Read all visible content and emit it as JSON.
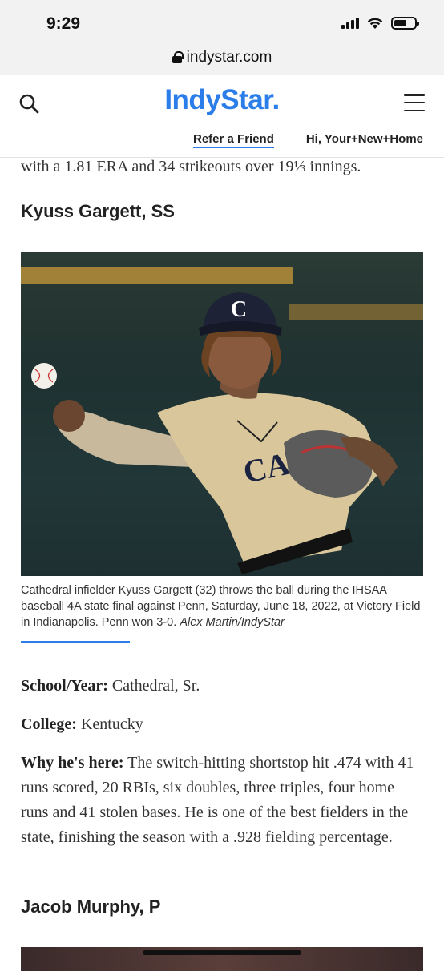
{
  "status": {
    "time": "9:29"
  },
  "browser": {
    "url": "indystar.com"
  },
  "header": {
    "logo_part1": "Indy",
    "logo_part2": "Star",
    "logo_dot": ".",
    "refer_label": "Refer a Friend",
    "greeting": "Hi, Your+New+Home"
  },
  "article": {
    "lead_line": "with a 1.81 ERA and 34 strikeouts over 19⅓ innings.",
    "player1": {
      "heading": "Kyuss Gargett, SS",
      "caption": "Cathedral infielder Kyuss Gargett (32) throws the ball during the IHSAA baseball 4A state final against Penn, Saturday, June 18, 2022, at Victory Field in Indianapolis. Penn won 3-0.",
      "credit": "Alex Martin/IndyStar",
      "school_label": "School/Year:",
      "school_value": "Cathedral, Sr.",
      "college_label": "College:",
      "college_value": "Kentucky",
      "why_label": "Why he's here:",
      "why_value": "The switch-hitting shortstop hit .474 with 41 runs scored, 20 RBIs, six doubles, three triples, four home runs and 41 stolen bases. He is one of the best fielders in the state, finishing the season with a .928 fielding percentage."
    },
    "player2": {
      "heading": "Jacob Murphy, P"
    },
    "photo_jersey_text": "CATHE",
    "photo_cap_letter": "C"
  }
}
